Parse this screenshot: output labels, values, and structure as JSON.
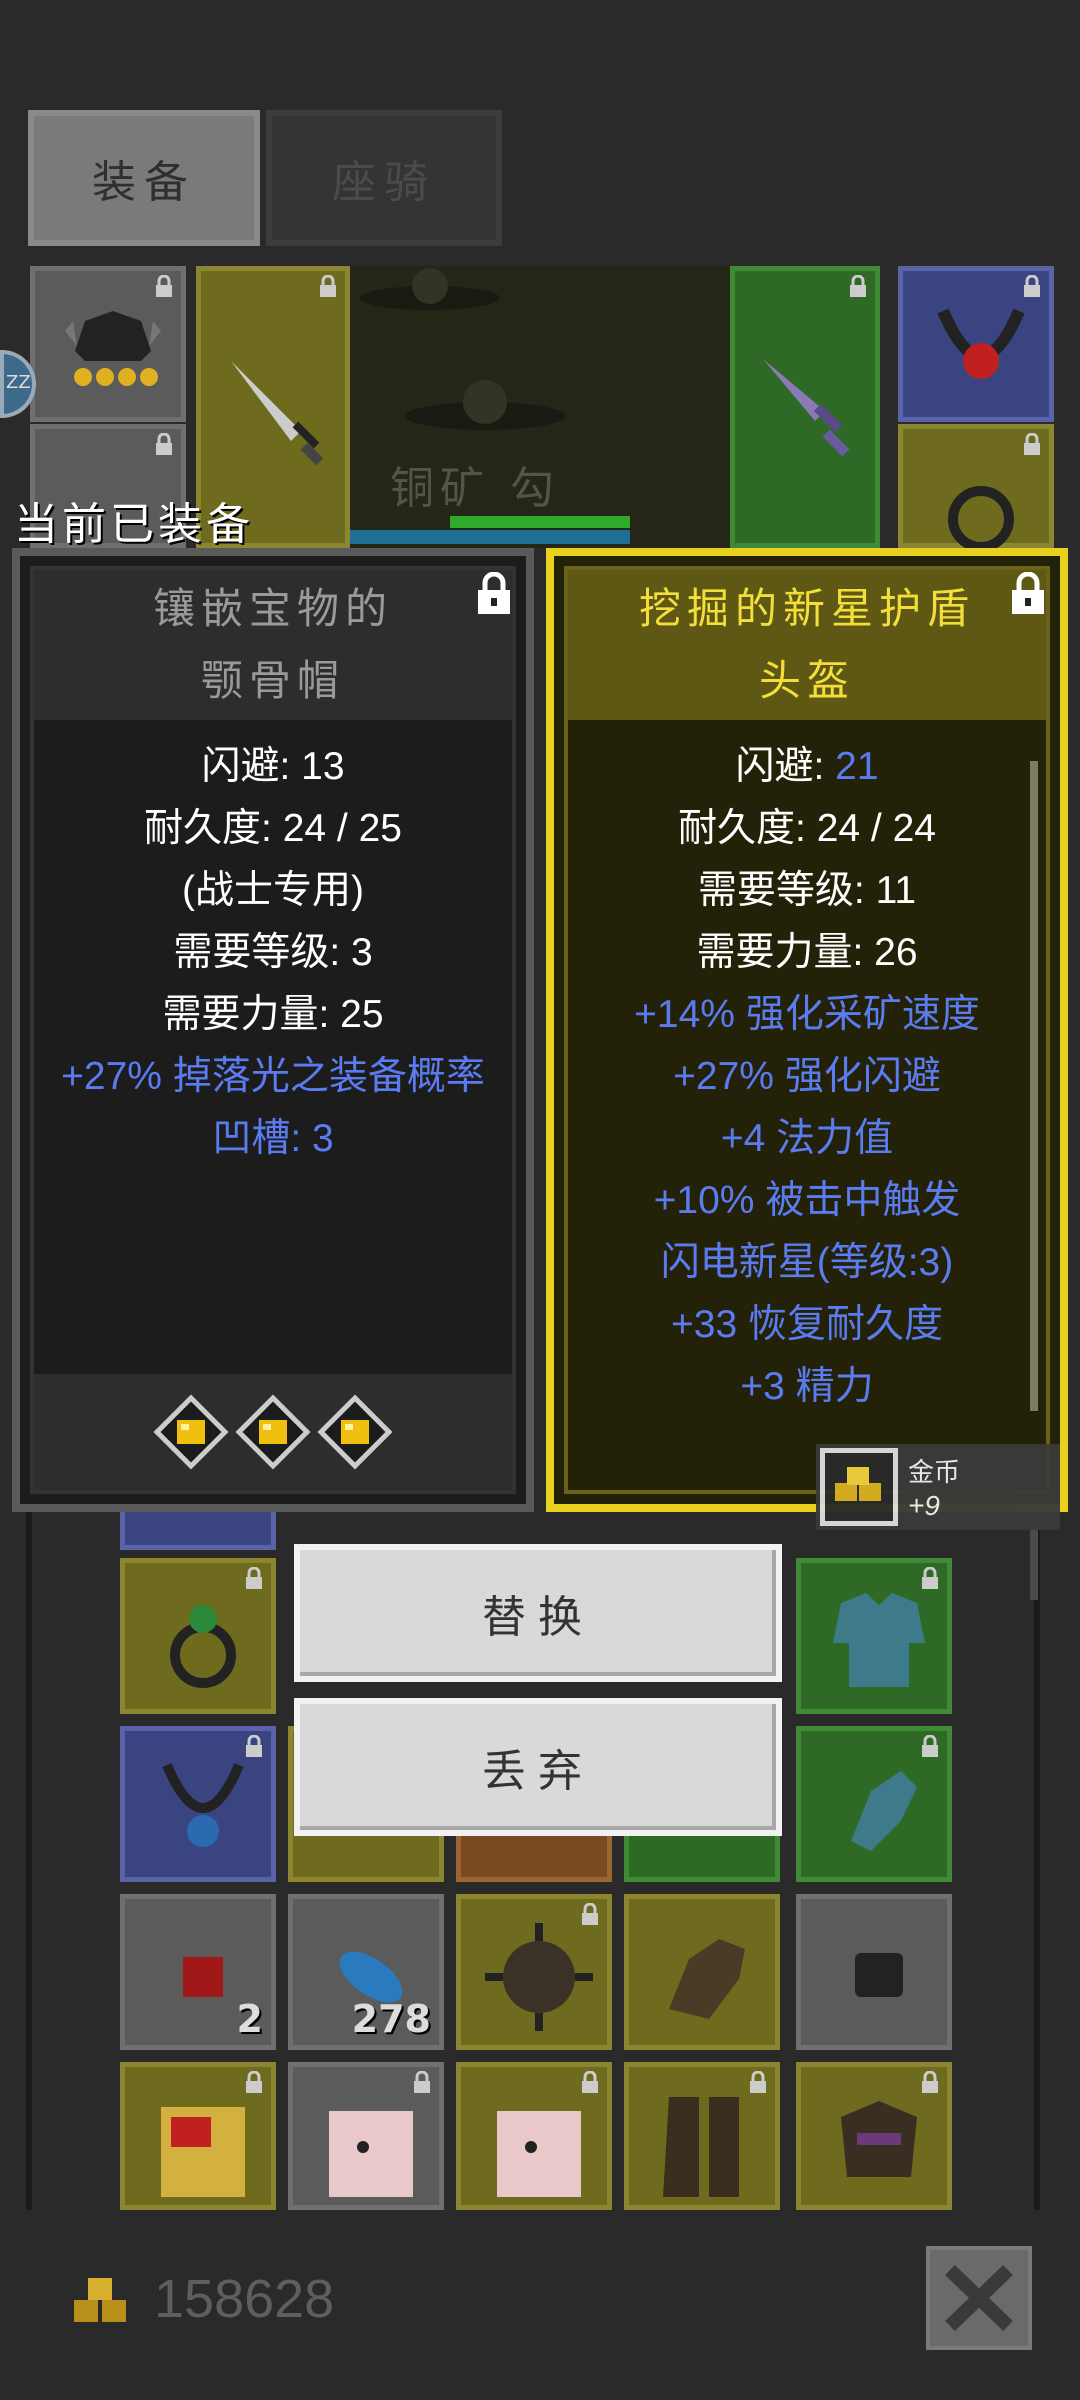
{
  "tabs": [
    {
      "label": "装备",
      "active": true
    },
    {
      "label": "座骑",
      "active": false
    }
  ],
  "scene": {
    "enemy_name": "铜矿 勾",
    "equipped_label": "当前已装备",
    "avatar_badge": "ZZ"
  },
  "equipped_item": {
    "title_line1": "镶嵌宝物的",
    "title_line2": "颚骨帽",
    "stats": [
      {
        "text": "闪避: 13",
        "color": "white"
      },
      {
        "text": "耐久度: 24 / 25",
        "color": "white"
      },
      {
        "text": "(战士专用)",
        "color": "white"
      },
      {
        "text": "需要等级: 3",
        "color": "white"
      },
      {
        "text": "需要力量: 25",
        "color": "white"
      },
      {
        "text": "+27% 掉落光之装备概率",
        "color": "blue"
      },
      {
        "text": "凹槽: 3",
        "color": "blue"
      }
    ],
    "gems": 3
  },
  "compared_item": {
    "title_line1": "挖掘的新星护盾",
    "title_line2": "头盔",
    "stats": [
      {
        "label": "闪避: ",
        "value": "21",
        "color": "mixed"
      },
      {
        "text": "耐久度: 24 / 24",
        "color": "white"
      },
      {
        "text": "需要等级: 11",
        "color": "white"
      },
      {
        "text": "需要力量: 26",
        "color": "white"
      },
      {
        "text": "+14% 强化采矿速度",
        "color": "blue"
      },
      {
        "text": "+27% 强化闪避",
        "color": "blue"
      },
      {
        "text": "+4 法力值",
        "color": "blue"
      },
      {
        "text": "+10% 被击中触发",
        "color": "blue"
      },
      {
        "text": "闪电新星(等级:3)",
        "color": "blue"
      },
      {
        "text": "+33 恢复耐久度",
        "color": "blue"
      },
      {
        "text": "+3 精力",
        "color": "blue"
      }
    ]
  },
  "currency_popup": {
    "name": "金币",
    "amount": "+9"
  },
  "buttons": {
    "replace": "替换",
    "discard": "丢弃"
  },
  "inventory_counts": {
    "red_gem": "2",
    "blue_feather": "278"
  },
  "footer": {
    "gold": "158628"
  },
  "colors": {
    "rarity_yellow": "#e8d11e",
    "magic_blue": "#5b7cf0"
  }
}
